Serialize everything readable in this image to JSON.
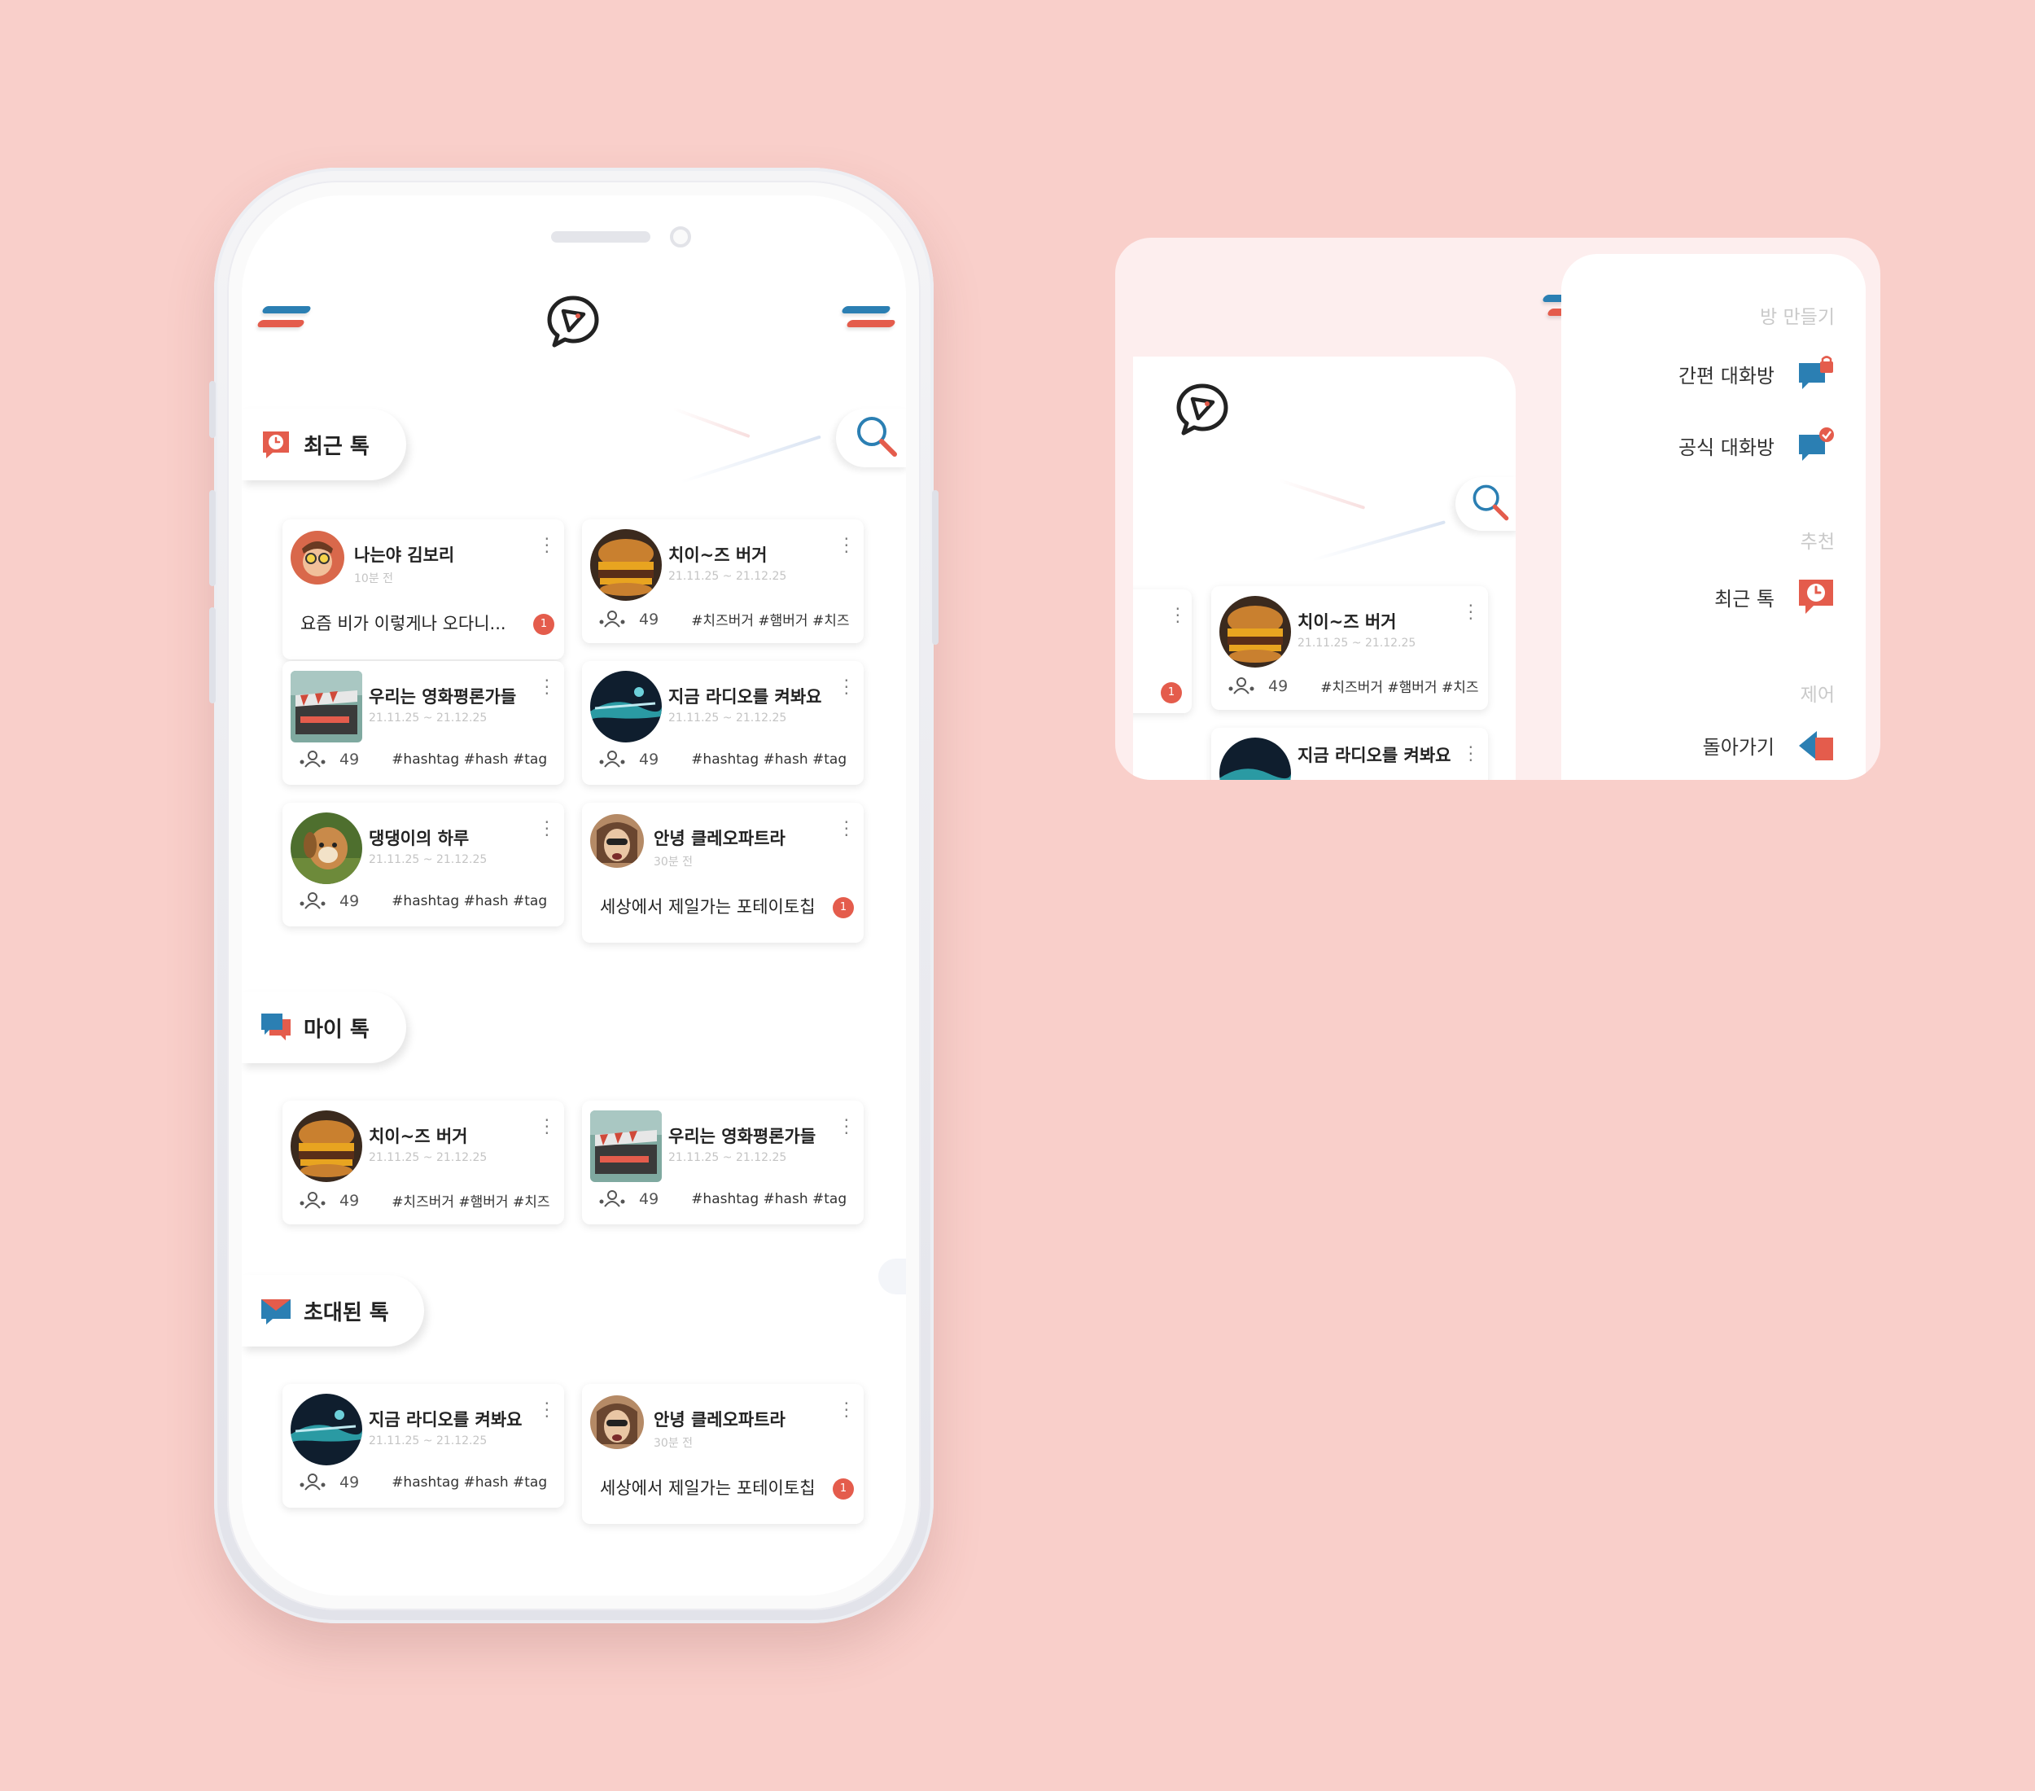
{
  "sections": {
    "recent": "최근 톡",
    "my": "마이 톡",
    "invited": "초대된 톡"
  },
  "recent_cards": [
    {
      "name": "나는야 김보리",
      "sub": "10분 전",
      "message": "요즘 비가 이렇게나 오다니...",
      "badge": "1"
    },
    {
      "name": "치이~즈 버거",
      "sub": "21.11.25 ~ 21.12.25",
      "count": "49",
      "tags": "#치즈버거 #햄버거 #치즈"
    },
    {
      "name": "우리는 영화평론가들",
      "sub": "21.11.25 ~ 21.12.25",
      "count": "49",
      "tags": "#hashtag #hash #tag"
    },
    {
      "name": "지금 라디오를 켜봐요",
      "sub": "21.11.25 ~ 21.12.25",
      "count": "49",
      "tags": "#hashtag #hash #tag"
    },
    {
      "name": "댕댕이의 하루",
      "sub": "21.11.25 ~ 21.12.25",
      "count": "49",
      "tags": "#hashtag #hash #tag"
    },
    {
      "name": "안녕 클레오파트라",
      "sub": "30분 전",
      "message": "세상에서 제일가는 포테이토칩",
      "badge": "1"
    }
  ],
  "my_cards": [
    {
      "name": "치이~즈 버거",
      "sub": "21.11.25 ~ 21.12.25",
      "count": "49",
      "tags": "#치즈버거 #햄버거 #치즈"
    },
    {
      "name": "우리는 영화평론가들",
      "sub": "21.11.25 ~ 21.12.25",
      "count": "49",
      "tags": "#hashtag #hash #tag"
    }
  ],
  "invited_cards": [
    {
      "name": "지금 라디오를 켜봐요",
      "sub": "21.11.25 ~ 21.12.25",
      "count": "49",
      "tags": "#hashtag #hash #tag"
    },
    {
      "name": "안녕 클레오파트라",
      "sub": "30분 전",
      "message": "세상에서 제일가는 포테이토칩",
      "badge": "1"
    }
  ],
  "preview": {
    "card": {
      "name": "치이~즈 버거",
      "sub": "21.11.25 ~ 21.12.25",
      "count": "49",
      "tags": "#치즈버거 #햄버거 #치즈"
    },
    "next_card_name": "지금 라디오를 켜봐요",
    "badge": "1",
    "menu": {
      "cat_create": "방 만들기",
      "quick_room": "간편 대화방",
      "official_room": "공식 대화방",
      "cat_recommend": "추천",
      "recent_talk": "최근 톡",
      "cat_control": "제어",
      "back": "돌아가기"
    }
  },
  "colors": {
    "background": "#f9cfca",
    "blue": "#2b7fb3",
    "red": "#e45c4c",
    "preview_bg": "#fdeeee"
  },
  "icons": [
    "hamburger-menu-icon",
    "chat-logo-icon",
    "search-icon",
    "clock-chat-icon",
    "chat-bubbles-icon",
    "invite-envelope-icon",
    "kebab-menu-icon",
    "members-icon",
    "lock-icon",
    "check-icon",
    "back-icon"
  ]
}
